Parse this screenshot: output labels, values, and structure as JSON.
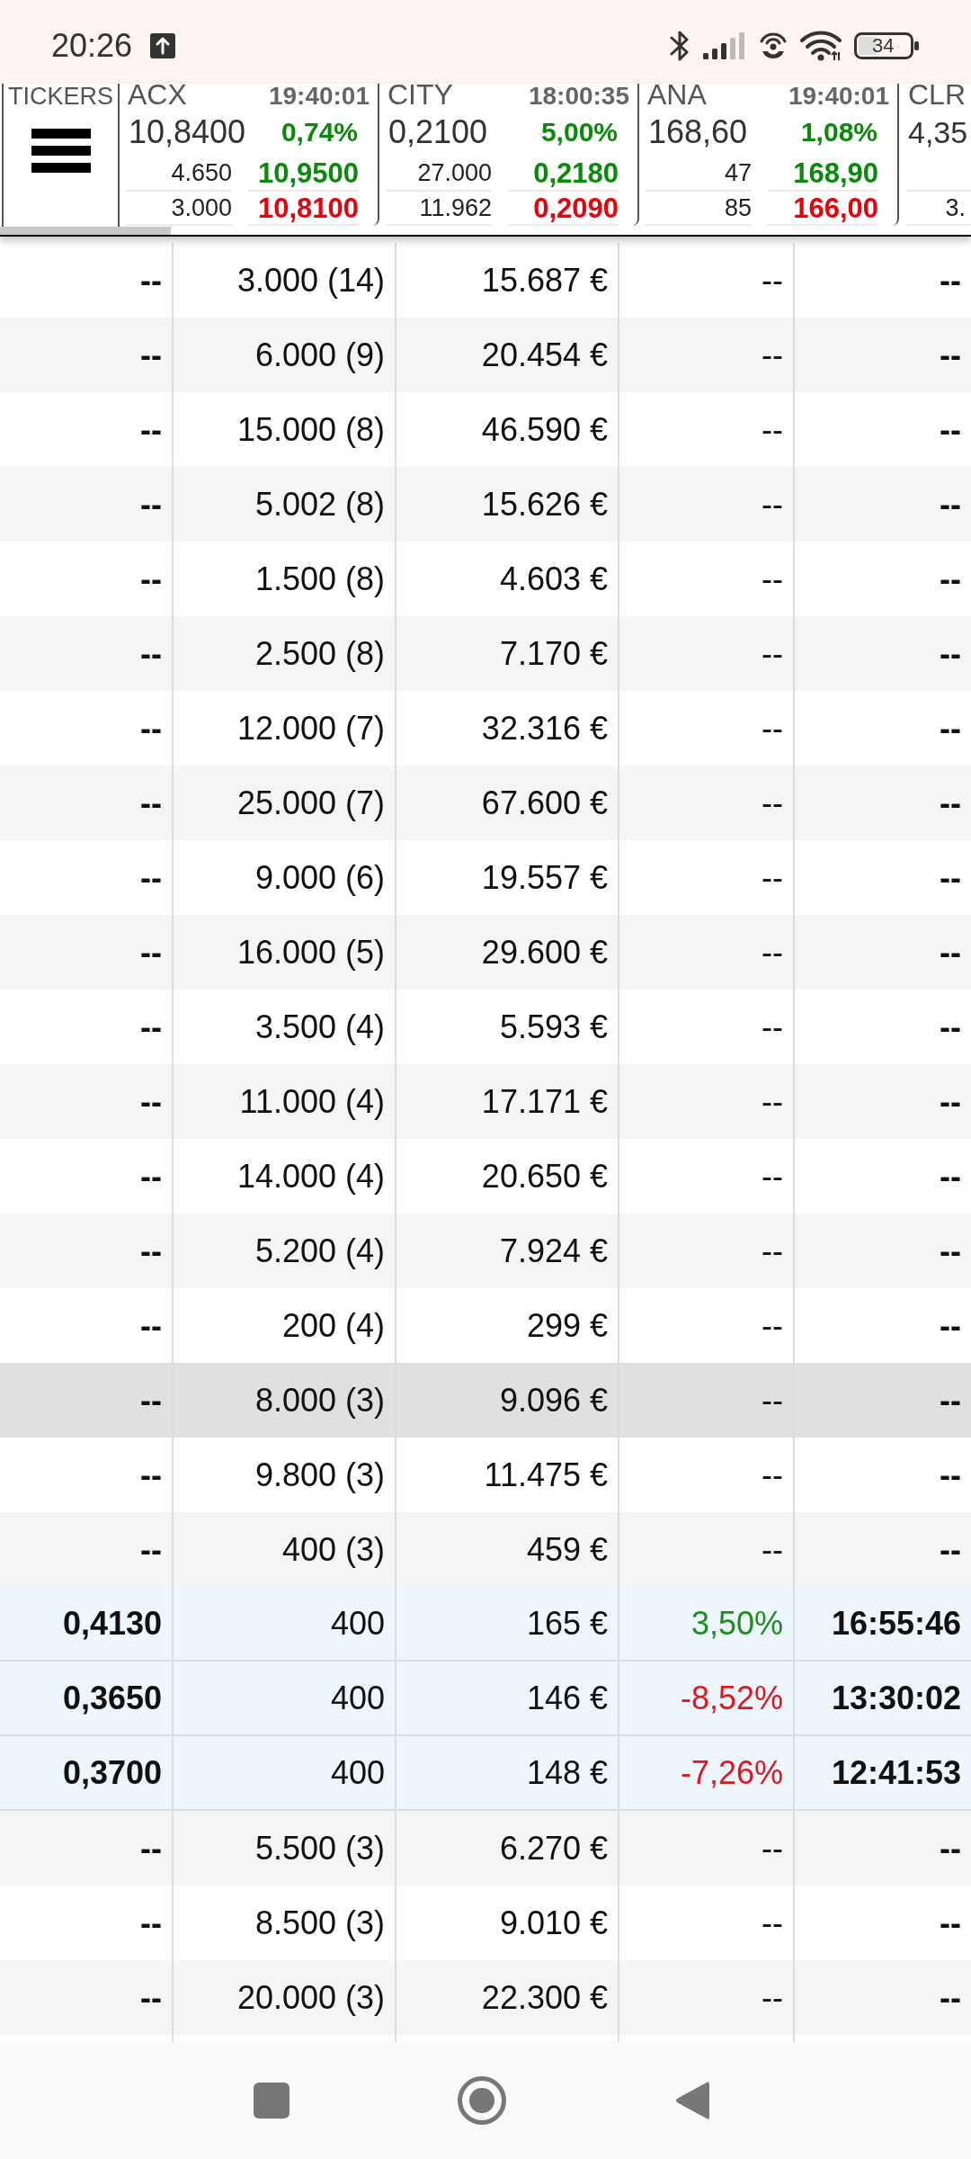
{
  "status_bar": {
    "time": "20:26",
    "battery": "34"
  },
  "tickers_panel": {
    "label": "TICKERS"
  },
  "tickers": [
    {
      "kind": "full",
      "symbol": "ACX",
      "time": "19:40:01",
      "price": "10,8400",
      "change": "0,74%",
      "color": "#0a8a0a",
      "bid_quantity": "4.650",
      "bid": "10,9500",
      "ask_quantity": "3.000",
      "ask": "10,8100"
    },
    {
      "kind": "full",
      "symbol": "CITY",
      "time": "18:00:35",
      "price": "0,2100",
      "change": "5,00%",
      "color": "#0a8a0a",
      "bid_quantity": "27.000",
      "bid": "0,2180",
      "ask_quantity": "11.962",
      "ask": "0,2090"
    },
    {
      "kind": "full",
      "symbol": "ANA",
      "time": "19:40:01",
      "price": "168,60",
      "change": "1,08%",
      "color": "#0a8a0a",
      "bid_quantity": "47",
      "bid": "168,90",
      "ask_quantity": "85",
      "ask": "166,00"
    },
    {
      "kind": "cut",
      "symbol": "CLR",
      "price": "4,35",
      "ask_quantity": "3."
    }
  ],
  "rows": [
    {
      "kind": "level",
      "selected": false,
      "cells": [
        "--",
        "3.000 (14)",
        "15.687 €",
        "--",
        "--"
      ]
    },
    {
      "kind": "level",
      "selected": false,
      "cells": [
        "--",
        "6.000 (9)",
        "20.454 €",
        "--",
        "--"
      ]
    },
    {
      "kind": "level",
      "selected": false,
      "cells": [
        "--",
        "15.000 (8)",
        "46.590 €",
        "--",
        "--"
      ]
    },
    {
      "kind": "level",
      "selected": false,
      "cells": [
        "--",
        "5.002 (8)",
        "15.626 €",
        "--",
        "--"
      ]
    },
    {
      "kind": "level",
      "selected": false,
      "cells": [
        "--",
        "1.500 (8)",
        "4.603 €",
        "--",
        "--"
      ]
    },
    {
      "kind": "level",
      "selected": false,
      "cells": [
        "--",
        "2.500 (8)",
        "7.170 €",
        "--",
        "--"
      ]
    },
    {
      "kind": "level",
      "selected": false,
      "cells": [
        "--",
        "12.000 (7)",
        "32.316 €",
        "--",
        "--"
      ]
    },
    {
      "kind": "level",
      "selected": false,
      "cells": [
        "--",
        "25.000 (7)",
        "67.600 €",
        "--",
        "--"
      ]
    },
    {
      "kind": "level",
      "selected": false,
      "cells": [
        "--",
        "9.000 (6)",
        "19.557 €",
        "--",
        "--"
      ]
    },
    {
      "kind": "level",
      "selected": false,
      "cells": [
        "--",
        "16.000 (5)",
        "29.600 €",
        "--",
        "--"
      ]
    },
    {
      "kind": "level",
      "selected": false,
      "cells": [
        "--",
        "3.500 (4)",
        "5.593 €",
        "--",
        "--"
      ]
    },
    {
      "kind": "level",
      "selected": false,
      "cells": [
        "--",
        "11.000 (4)",
        "17.171 €",
        "--",
        "--"
      ]
    },
    {
      "kind": "level",
      "selected": false,
      "cells": [
        "--",
        "14.000 (4)",
        "20.650 €",
        "--",
        "--"
      ]
    },
    {
      "kind": "level",
      "selected": false,
      "cells": [
        "--",
        "5.200 (4)",
        "7.924 €",
        "--",
        "--"
      ]
    },
    {
      "kind": "level",
      "selected": false,
      "cells": [
        "--",
        "200 (4)",
        "299 €",
        "--",
        "--"
      ]
    },
    {
      "kind": "level",
      "selected": true,
      "cells": [
        "--",
        "8.000 (3)",
        "9.096 €",
        "--",
        "--"
      ]
    },
    {
      "kind": "level",
      "selected": false,
      "cells": [
        "--",
        "9.800 (3)",
        "11.475 €",
        "--",
        "--"
      ]
    },
    {
      "kind": "level",
      "selected": false,
      "cells": [
        "--",
        "400 (3)",
        "459 €",
        "--",
        "--"
      ]
    },
    {
      "kind": "trade",
      "selected": false,
      "color": "#1e8c1e",
      "cells": [
        "0,4130",
        "400",
        "165 €",
        "3,50%",
        "16:55:46"
      ]
    },
    {
      "kind": "trade",
      "selected": false,
      "color": "#e3161b",
      "cells": [
        "0,3650",
        "400",
        "146 €",
        "-8,52%",
        "13:30:02"
      ]
    },
    {
      "kind": "trade",
      "selected": false,
      "color": "#e3161b",
      "cells": [
        "0,3700",
        "400",
        "148 €",
        "-7,26%",
        "12:41:53"
      ]
    },
    {
      "kind": "level",
      "selected": false,
      "cells": [
        "--",
        "5.500 (3)",
        "6.270 €",
        "--",
        "--"
      ]
    },
    {
      "kind": "level",
      "selected": false,
      "cells": [
        "--",
        "8.500 (3)",
        "9.010 €",
        "--",
        "--"
      ]
    },
    {
      "kind": "level",
      "selected": false,
      "cells": [
        "--",
        "20.000 (3)",
        "22.300 €",
        "--",
        "--"
      ]
    }
  ]
}
